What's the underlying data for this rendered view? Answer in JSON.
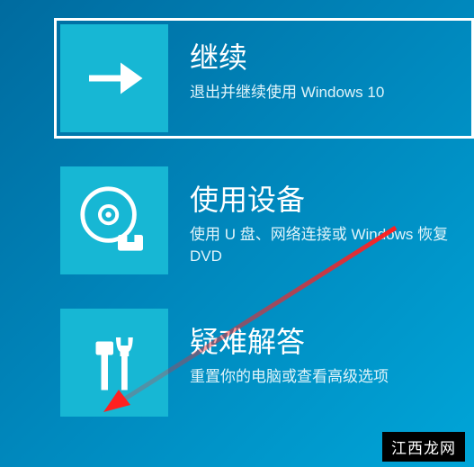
{
  "options": [
    {
      "title": "继续",
      "subtitle": "退出并继续使用 Windows 10"
    },
    {
      "title": "使用设备",
      "subtitle": "使用 U 盘、网络连接或 Windows 恢复 DVD"
    },
    {
      "title": "疑难解答",
      "subtitle": "重置你的电脑或查看高级选项"
    }
  ],
  "watermark": "江西龙网"
}
